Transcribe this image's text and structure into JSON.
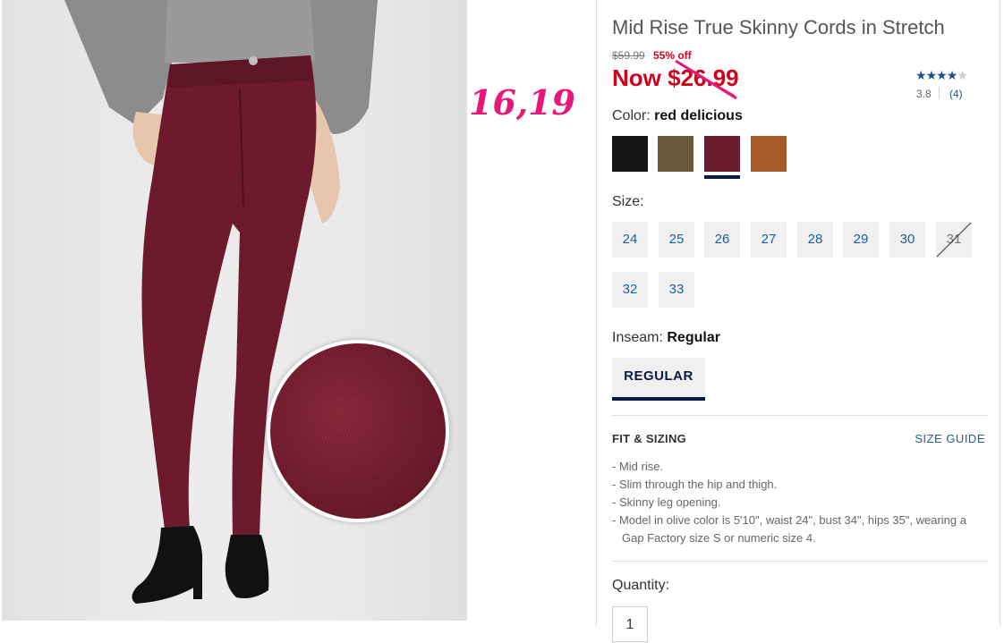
{
  "product": {
    "title": "Mid Rise True Skinny Cords in Stretch",
    "was_price": "$59.99",
    "discount": "55% off",
    "now_price": "Now $26.99"
  },
  "annotation": {
    "handwritten_price": "16,19"
  },
  "rating": {
    "stars": 3.8,
    "value": "3.8",
    "count": "(4)"
  },
  "color": {
    "label": "Color:",
    "selected": "red delicious",
    "swatches": [
      {
        "name": "black",
        "hex": "#141414"
      },
      {
        "name": "olive",
        "hex": "#6b5a3a"
      },
      {
        "name": "red delicious",
        "hex": "#6d1a2c"
      },
      {
        "name": "cognac",
        "hex": "#a85a2a"
      }
    ]
  },
  "size": {
    "label": "Size:",
    "options": [
      "24",
      "25",
      "26",
      "27",
      "28",
      "29",
      "30",
      "31",
      "32",
      "33"
    ],
    "unavailable": [
      "31"
    ]
  },
  "inseam": {
    "label": "Inseam:",
    "selected": "Regular",
    "options": [
      "REGULAR"
    ]
  },
  "fit": {
    "title": "FIT & SIZING",
    "size_guide": "SIZE GUIDE",
    "bullets": [
      "- Mid rise.",
      "- Slim through the hip and thigh.",
      "- Skinny leg opening.",
      "- Model in olive color is 5'10\", waist 24\", bust 34\", hips 35\", wearing a Gap Factory size S or numeric size 4."
    ]
  },
  "quantity": {
    "label": "Quantity:",
    "value": "1"
  },
  "colors": {
    "sale_red": "#d0021b",
    "link_blue": "#1d5d9b",
    "navy": "#0b1a45",
    "annotation_pink": "#e6187a"
  }
}
